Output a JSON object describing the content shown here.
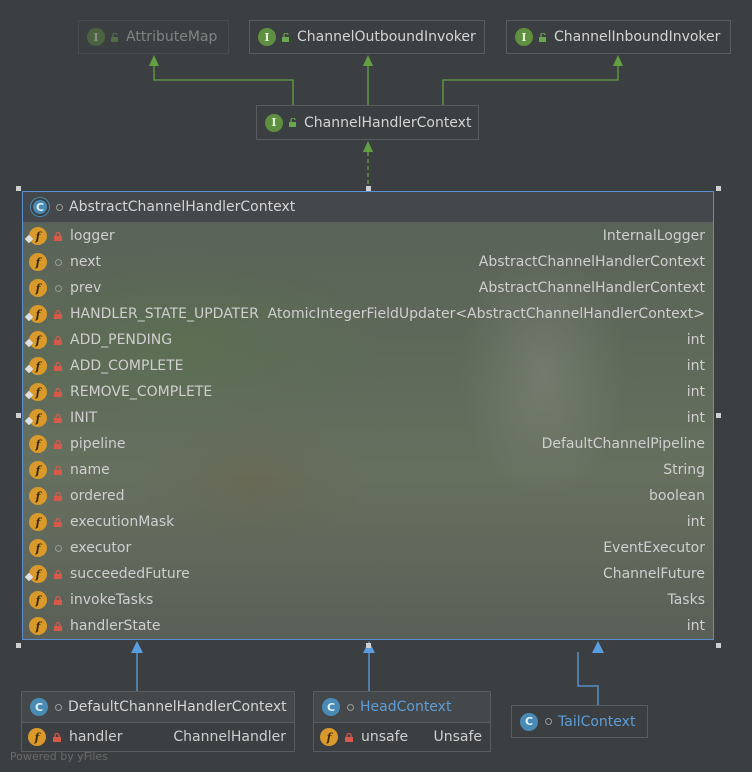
{
  "interfaces": [
    {
      "name": "AttributeMap",
      "kind": "I"
    },
    {
      "name": "ChannelOutboundInvoker",
      "kind": "I"
    },
    {
      "name": "ChannelInboundInvoker",
      "kind": "I"
    }
  ],
  "context": {
    "name": "ChannelHandlerContext",
    "kind": "I"
  },
  "main": {
    "name": "AbstractChannelHandlerContext",
    "kind": "C",
    "fields": [
      {
        "name": "logger",
        "type": "InternalLogger"
      },
      {
        "name": "next",
        "type": "AbstractChannelHandlerContext"
      },
      {
        "name": "prev",
        "type": "AbstractChannelHandlerContext"
      },
      {
        "name": "HANDLER_STATE_UPDATER",
        "type": "AtomicIntegerFieldUpdater<AbstractChannelHandlerContext>"
      },
      {
        "name": "ADD_PENDING",
        "type": "int"
      },
      {
        "name": "ADD_COMPLETE",
        "type": "int"
      },
      {
        "name": "REMOVE_COMPLETE",
        "type": "int"
      },
      {
        "name": "INIT",
        "type": "int"
      },
      {
        "name": "pipeline",
        "type": "DefaultChannelPipeline"
      },
      {
        "name": "name",
        "type": "String"
      },
      {
        "name": "ordered",
        "type": "boolean"
      },
      {
        "name": "executionMask",
        "type": "int"
      },
      {
        "name": "executor",
        "type": "EventExecutor"
      },
      {
        "name": "succeededFuture",
        "type": "ChannelFuture"
      },
      {
        "name": "invokeTasks",
        "type": "Tasks"
      },
      {
        "name": "handlerState",
        "type": "int"
      }
    ]
  },
  "subclasses": [
    {
      "name": "DefaultChannelHandlerContext",
      "kind": "C",
      "field": {
        "name": "handler",
        "type": "ChannelHandler"
      }
    },
    {
      "name": "HeadContext",
      "kind": "C",
      "field": {
        "name": "unsafe",
        "type": "Unsafe"
      }
    },
    {
      "name": "TailContext",
      "kind": "C"
    }
  ],
  "badges": {
    "field": "f"
  },
  "colors": {
    "interface": "#5f8f40",
    "class": "#4a8bb5",
    "field": "#d99a2b",
    "selection": "#5b8fcf",
    "edge": "#62a044",
    "subedge": "#5b9ee0"
  },
  "watermark": "Powered by yFiles"
}
